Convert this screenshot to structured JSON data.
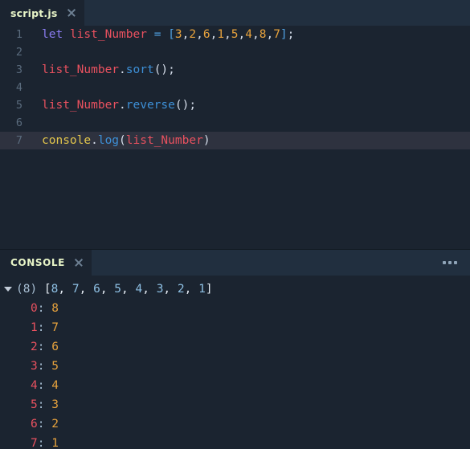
{
  "theme": {
    "editor_bg": "#1b2430",
    "tabbar_bg": "#212f3f",
    "active_line_bg": "#2e323f",
    "tab_label_color": "#e8f5c8",
    "gutter_color": "#5a6b7d",
    "keyword_color": "#8a7bf0",
    "variable_color": "#e8515f",
    "number_color": "#e8a33d",
    "function_color": "#3d8fd6",
    "object_color": "#e3c64c",
    "operator_color": "#4f9fe0",
    "console_key_color": "#e8515f",
    "console_value_color": "#e8a33d",
    "console_array_num_color": "#8ec0e4"
  },
  "editor": {
    "tab": {
      "label": "script.js",
      "close_icon": "close-icon"
    },
    "lines": [
      {
        "number": "1",
        "active": false,
        "tokens": [
          {
            "text": "let",
            "cls": "t-kw"
          },
          {
            "text": " ",
            "cls": "t-pun"
          },
          {
            "text": "list_Number",
            "cls": "t-var"
          },
          {
            "text": " ",
            "cls": "t-pun"
          },
          {
            "text": "=",
            "cls": "t-op"
          },
          {
            "text": " ",
            "cls": "t-pun"
          },
          {
            "text": "[",
            "cls": "t-brk"
          },
          {
            "text": "3",
            "cls": "t-num"
          },
          {
            "text": ",",
            "cls": "t-pun"
          },
          {
            "text": "2",
            "cls": "t-num"
          },
          {
            "text": ",",
            "cls": "t-pun"
          },
          {
            "text": "6",
            "cls": "t-num"
          },
          {
            "text": ",",
            "cls": "t-pun"
          },
          {
            "text": "1",
            "cls": "t-num"
          },
          {
            "text": ",",
            "cls": "t-pun"
          },
          {
            "text": "5",
            "cls": "t-num"
          },
          {
            "text": ",",
            "cls": "t-pun"
          },
          {
            "text": "4",
            "cls": "t-num"
          },
          {
            "text": ",",
            "cls": "t-pun"
          },
          {
            "text": "8",
            "cls": "t-num"
          },
          {
            "text": ",",
            "cls": "t-pun"
          },
          {
            "text": "7",
            "cls": "t-num"
          },
          {
            "text": "]",
            "cls": "t-brk"
          },
          {
            "text": ";",
            "cls": "t-pun"
          }
        ]
      },
      {
        "number": "2",
        "active": false,
        "tokens": []
      },
      {
        "number": "3",
        "active": false,
        "tokens": [
          {
            "text": "list_Number",
            "cls": "t-var"
          },
          {
            "text": ".",
            "cls": "t-pun"
          },
          {
            "text": "sort",
            "cls": "t-fn"
          },
          {
            "text": "();",
            "cls": "t-pun"
          }
        ]
      },
      {
        "number": "4",
        "active": false,
        "tokens": []
      },
      {
        "number": "5",
        "active": false,
        "tokens": [
          {
            "text": "list_Number",
            "cls": "t-var"
          },
          {
            "text": ".",
            "cls": "t-pun"
          },
          {
            "text": "reverse",
            "cls": "t-fn"
          },
          {
            "text": "();",
            "cls": "t-pun"
          }
        ]
      },
      {
        "number": "6",
        "active": false,
        "tokens": []
      },
      {
        "number": "7",
        "active": true,
        "tokens": [
          {
            "text": "console",
            "cls": "t-obj"
          },
          {
            "text": ".",
            "cls": "t-pun"
          },
          {
            "text": "log",
            "cls": "t-fn"
          },
          {
            "text": "(",
            "cls": "t-pun"
          },
          {
            "text": "list_Number",
            "cls": "t-var"
          },
          {
            "text": ")",
            "cls": "t-pun"
          }
        ]
      }
    ]
  },
  "console": {
    "tab_label": "CONSOLE",
    "close_icon": "close-icon",
    "menu_icon": "ellipsis-icon",
    "output": {
      "disclosure_icon": "triangle-down-icon",
      "count_label": "(8)",
      "array_open": " [",
      "array_close": "]",
      "separator": ", ",
      "array_values": [
        "8",
        "7",
        "6",
        "5",
        "4",
        "3",
        "2",
        "1"
      ],
      "properties": [
        {
          "key": "0",
          "colon": ":",
          "value": "8"
        },
        {
          "key": "1",
          "colon": ":",
          "value": "7"
        },
        {
          "key": "2",
          "colon": ":",
          "value": "6"
        },
        {
          "key": "3",
          "colon": ":",
          "value": "5"
        },
        {
          "key": "4",
          "colon": ":",
          "value": "4"
        },
        {
          "key": "5",
          "colon": ":",
          "value": "3"
        },
        {
          "key": "6",
          "colon": ":",
          "value": "2"
        },
        {
          "key": "7",
          "colon": ":",
          "value": "1"
        }
      ]
    }
  }
}
